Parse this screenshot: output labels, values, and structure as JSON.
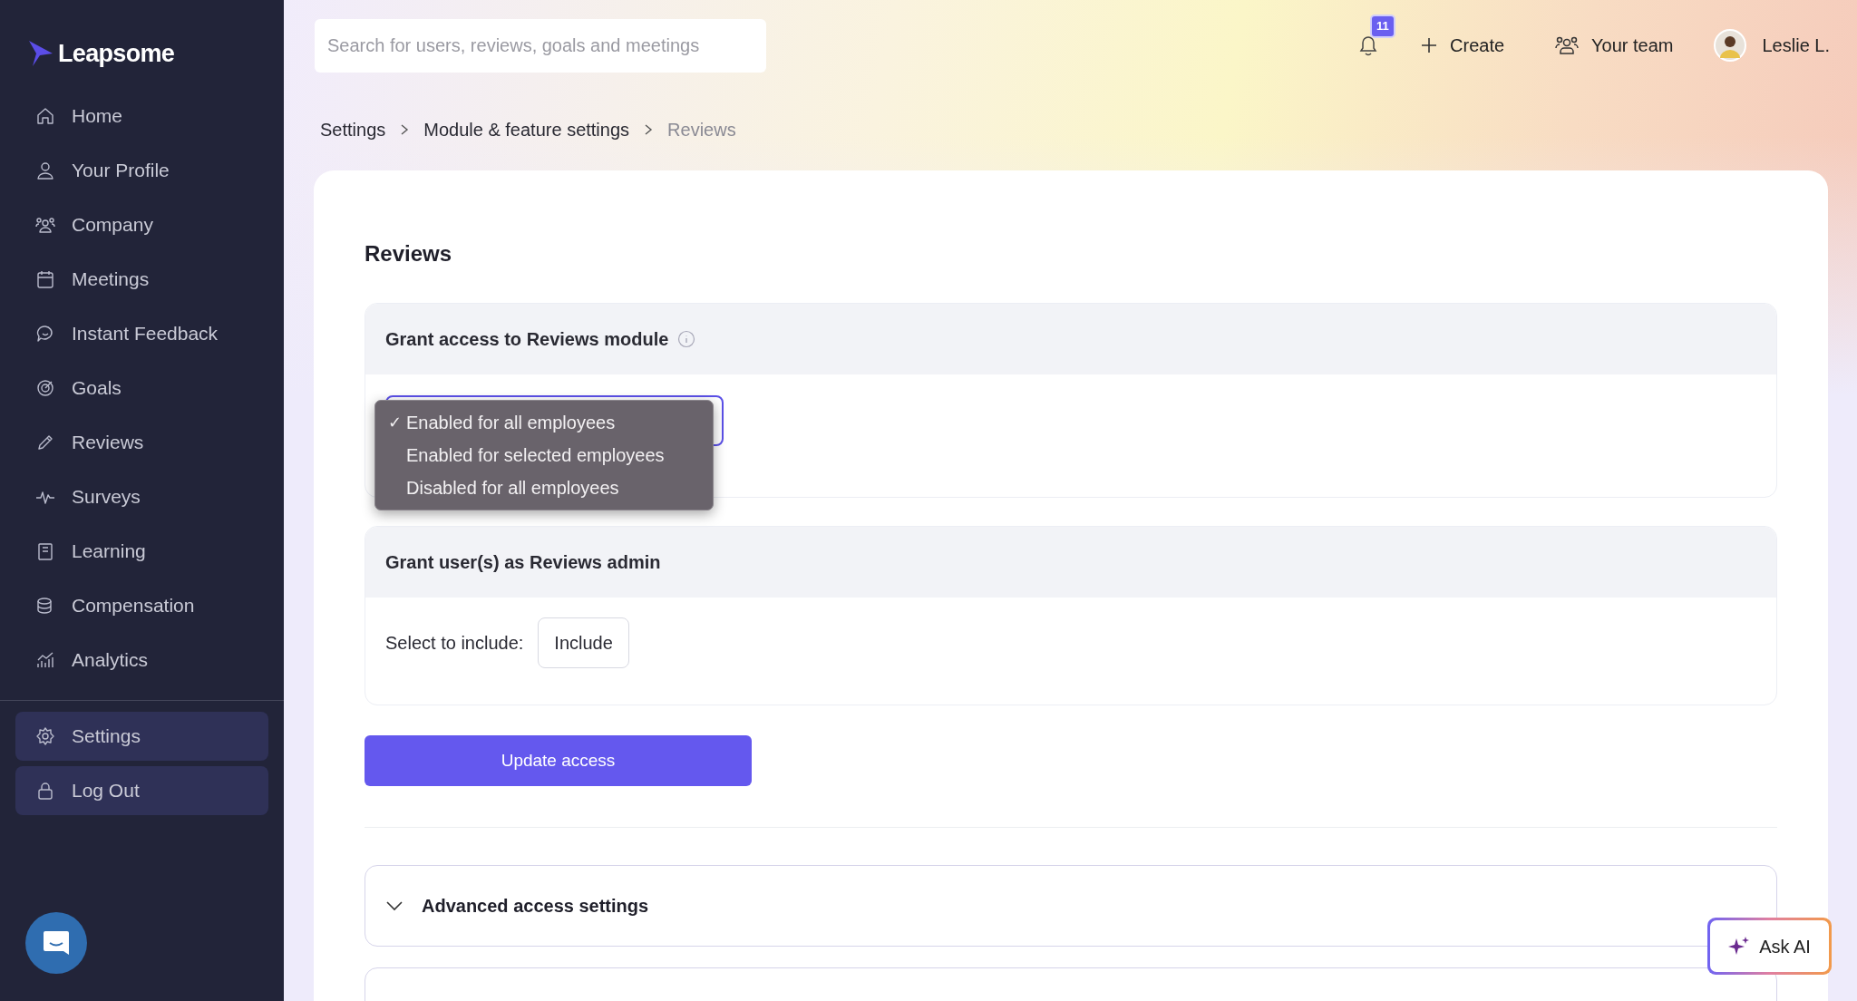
{
  "sidebar": {
    "logo": "Leapsome",
    "items": [
      {
        "label": "Home"
      },
      {
        "label": "Your Profile"
      },
      {
        "label": "Company"
      },
      {
        "label": "Meetings"
      },
      {
        "label": "Instant Feedback"
      },
      {
        "label": "Goals"
      },
      {
        "label": "Reviews"
      },
      {
        "label": "Surveys"
      },
      {
        "label": "Learning"
      },
      {
        "label": "Compensation"
      },
      {
        "label": "Analytics"
      }
    ],
    "bottom_items": [
      {
        "label": "Settings"
      },
      {
        "label": "Log Out"
      }
    ]
  },
  "topbar": {
    "search": {
      "placeholder": "Search for users, reviews, goals and meetings"
    },
    "notifications": "11",
    "create": "Create",
    "team": "Your team",
    "user": "Leslie L."
  },
  "breadcrumbs": [
    "Settings",
    "Module & feature settings",
    "Reviews"
  ],
  "title": "Reviews",
  "access_section": {
    "heading": "Grant access to Reviews module",
    "check_mark": "✓",
    "options": [
      {
        "label": "Enabled for all employees",
        "selected": true
      },
      {
        "label": "Enabled for selected employees",
        "selected": false
      },
      {
        "label": "Disabled for all employees",
        "selected": false
      }
    ]
  },
  "admin_section": {
    "heading": "Grant user(s) as Reviews admin",
    "label": "Select to include:",
    "button": "Include"
  },
  "update_button": "Update access",
  "advanced": {
    "label": "Advanced access settings",
    "expanded": false
  },
  "ask_ai": "Ask AI"
}
